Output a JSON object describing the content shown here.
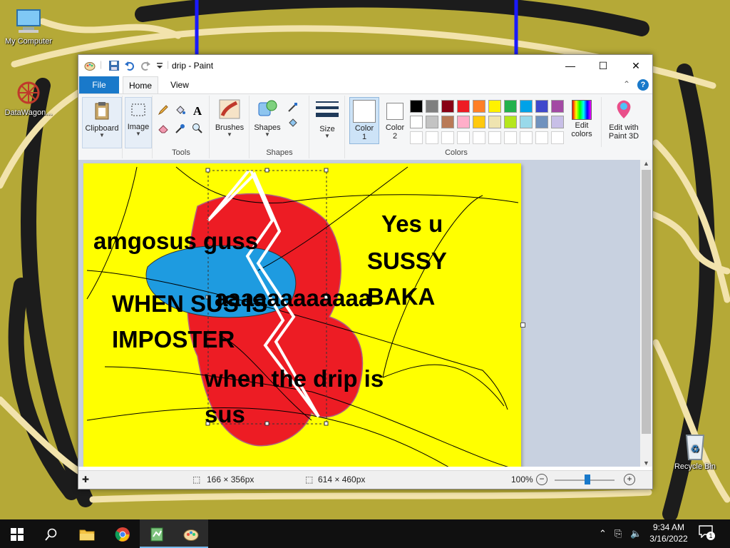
{
  "desktop": {
    "icons": [
      {
        "label": "My Computer"
      },
      {
        "label": "DataWagon..."
      },
      {
        "label": "Recycle Bin"
      }
    ]
  },
  "window": {
    "title": "drip - Paint",
    "tabs": [
      "File",
      "Home",
      "View"
    ]
  },
  "ribbon": {
    "clipboard": "Clipboard",
    "image": "Image",
    "tools": "Tools",
    "brushes": "Brushes",
    "shapes_btn": "Shapes",
    "shapes_group": "Shapes",
    "size": "Size",
    "color1": "Color\n1",
    "color1_a": "Color",
    "color1_b": "1",
    "color2_a": "Color",
    "color2_b": "2",
    "edit_colors_a": "Edit",
    "edit_colors_b": "colors",
    "paint3d_a": "Edit with",
    "paint3d_b": "Paint 3D",
    "colors_group": "Colors",
    "text_tool_glyph": "A",
    "palette_row1": [
      "#000000",
      "#7f7f7f",
      "#880015",
      "#ed1c24",
      "#ff7f27",
      "#fff200",
      "#22b14c",
      "#00a2e8",
      "#3f48cc",
      "#a349a4"
    ],
    "palette_row2": [
      "#ffffff",
      "#c3c3c3",
      "#b97a57",
      "#ffaec9",
      "#ffc90e",
      "#efe4b0",
      "#b5e61d",
      "#99d9ea",
      "#7092be",
      "#c8bfe7"
    ]
  },
  "canvas_text": {
    "t1": "amgosus guss",
    "t2": "Yes u",
    "t3": "SUSSY",
    "t4": "BAKA",
    "t5": "WHEN SUS IS",
    "t6": "aaaaaaaaaaaa",
    "t7": "IMPOSTER",
    "t8": "when the drip is",
    "t9": "sus"
  },
  "status": {
    "selection_size": "166 × 356px",
    "image_size": "614 × 460px",
    "zoom": "100%",
    "zoom_level_percent": 100
  },
  "taskbar": {
    "time": "9:34 AM",
    "date": "3/16/2022",
    "notification_count": "1"
  }
}
